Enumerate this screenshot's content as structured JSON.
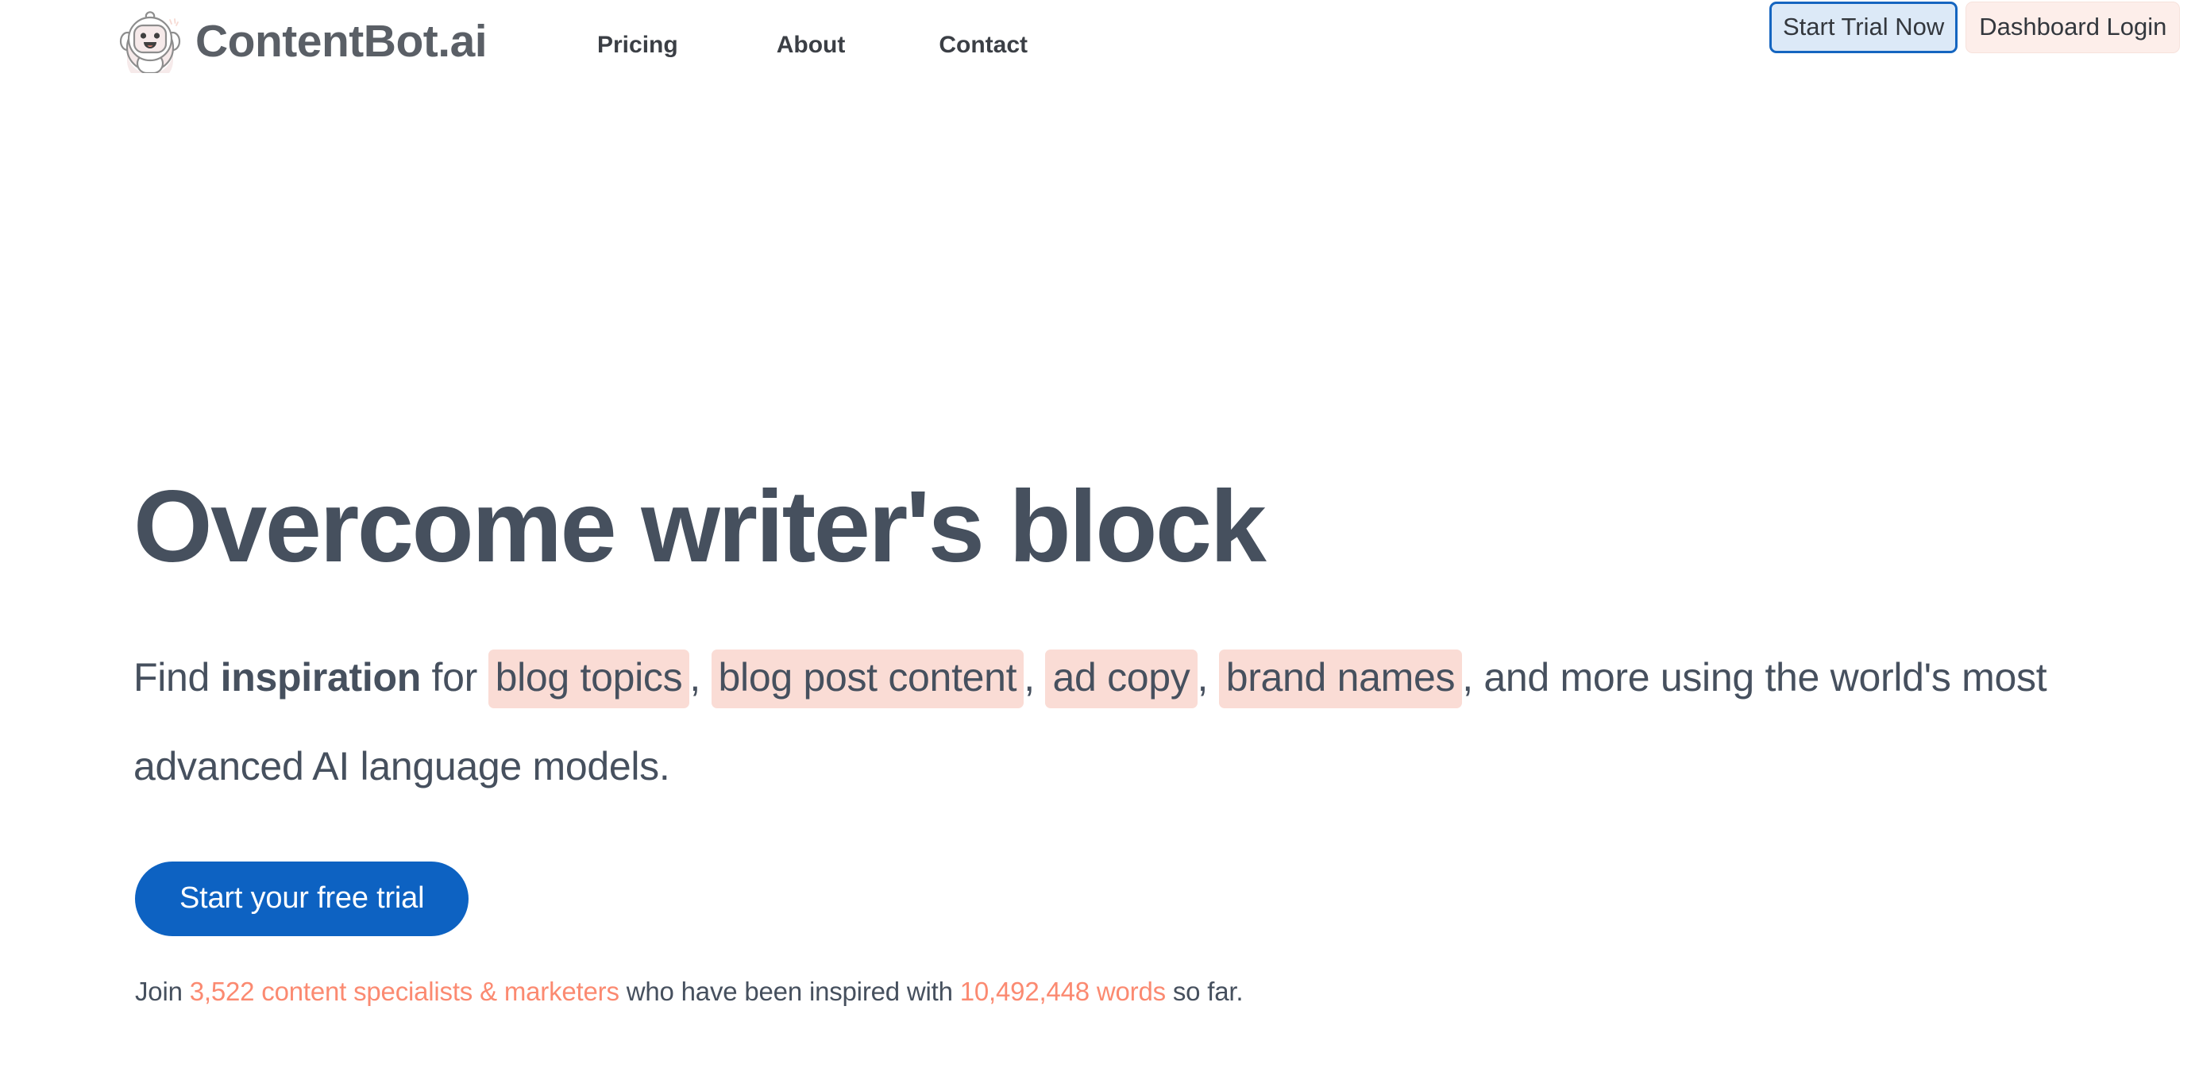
{
  "brand": {
    "name": "ContentBot.ai",
    "logo_icon": "robot-mascot-icon",
    "logo_colors": {
      "fill": "#f6eaea",
      "outline": "#8d8d8d",
      "sparkle": "#f6d9d2"
    }
  },
  "nav": {
    "items": [
      {
        "label": "Pricing",
        "name": "nav-link-pricing"
      },
      {
        "label": "About",
        "name": "nav-link-about"
      },
      {
        "label": "Contact",
        "name": "nav-link-contact"
      }
    ]
  },
  "header_actions": {
    "start_trial_label": "Start Trial Now",
    "dashboard_login_label": "Dashboard Login",
    "start_trial_state": "focused",
    "colors": {
      "start_trial_border": "#1565c0",
      "start_trial_bg": "#dce9f7",
      "dashboard_login_bg": "#fdeeea"
    }
  },
  "hero": {
    "title": "Overcome writer's block",
    "subheading": {
      "lead": "Find ",
      "emphasis": "inspiration",
      "after_emphasis": " for ",
      "highlights": [
        "blog topics",
        "blog post content",
        "ad copy",
        "brand names"
      ],
      "separator": ", ",
      "tail": ", and more using the world's most advanced AI language models."
    },
    "cta_label": "Start your free trial",
    "social_proof": {
      "prefix": "Join ",
      "users_count": "3,522 content specialists & marketers",
      "middle": " who have been inspired with ",
      "words_count": "10,492,448 words",
      "suffix": " so far."
    },
    "colors": {
      "title": "#46505e",
      "highlight_bg": "#fadcd5",
      "cta_bg": "#0d62c2",
      "accent": "#fb8a71"
    }
  }
}
